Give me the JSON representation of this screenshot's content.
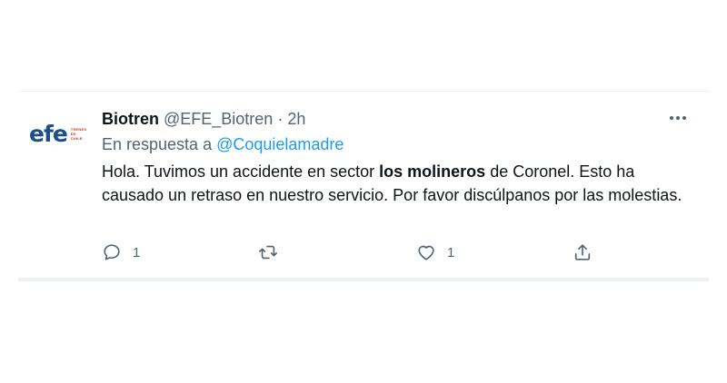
{
  "tweet": {
    "avatar": {
      "logo_text": "efe",
      "logo_subtext": [
        "TRENES",
        "DE",
        "CHILE"
      ]
    },
    "display_name": "Biotren",
    "handle": "@EFE_Biotren",
    "separator": "·",
    "time": "2h",
    "reply_prefix": "En respuesta a",
    "reply_mention": "@Coquielamadre",
    "text_before": "Hola. Tuvimos un accidente en sector ",
    "text_bold": "los molineros",
    "text_after": " de Coronel. Esto ha causado un retraso en nuestro servicio. Por favor discúlpanos por las molestias.",
    "actions": {
      "reply": {
        "icon": "comment-icon",
        "count": "1"
      },
      "retweet": {
        "icon": "retweet-icon",
        "count": ""
      },
      "like": {
        "icon": "heart-icon",
        "count": "1"
      },
      "share": {
        "icon": "share-icon",
        "count": ""
      }
    },
    "more_icon": "more-horizontal-icon"
  }
}
